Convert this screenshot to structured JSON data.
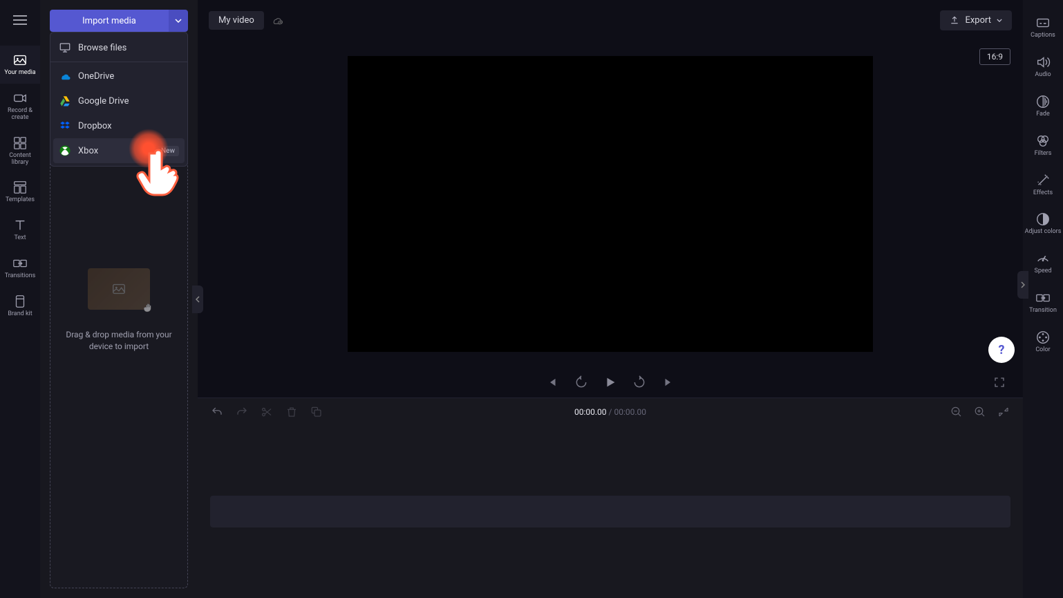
{
  "left_rail": {
    "items": [
      {
        "label": "Your media"
      },
      {
        "label": "Record & create"
      },
      {
        "label": "Content library"
      },
      {
        "label": "Templates"
      },
      {
        "label": "Text"
      },
      {
        "label": "Transitions"
      },
      {
        "label": "Brand kit"
      }
    ]
  },
  "import": {
    "button_label": "Import media",
    "dropdown": {
      "browse": "Browse files",
      "onedrive": "OneDrive",
      "gdrive": "Google Drive",
      "dropbox": "Dropbox",
      "xbox": "Xbox",
      "new_badge": "New"
    },
    "drop_text": "Drag & drop media from your device to import"
  },
  "top": {
    "title": "My video",
    "export": "Export"
  },
  "preview": {
    "aspect": "16:9"
  },
  "timeline": {
    "current": "00:00.00",
    "total": "00:00.00",
    "separator": " / "
  },
  "right_rail": {
    "items": [
      {
        "label": "Captions"
      },
      {
        "label": "Audio"
      },
      {
        "label": "Fade"
      },
      {
        "label": "Filters"
      },
      {
        "label": "Effects"
      },
      {
        "label": "Adjust colors"
      },
      {
        "label": "Speed"
      },
      {
        "label": "Transition"
      },
      {
        "label": "Color"
      }
    ]
  },
  "help": {
    "symbol": "?"
  }
}
